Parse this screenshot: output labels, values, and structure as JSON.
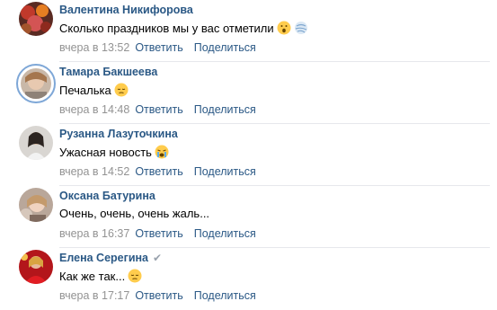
{
  "comments": [
    {
      "author": "Валентина Никифорова",
      "verified": false,
      "text": "Сколько праздников мы у вас отметили",
      "emojis": [
        "astonished-face",
        "wind-face"
      ],
      "date": "вчера в 13:52",
      "reply_label": "Ответить",
      "share_label": "Поделиться",
      "avatar_icon": "avatar-photo"
    },
    {
      "author": "Тамара Бакшеева",
      "verified": false,
      "text": "Печалька",
      "emojis": [
        "pensive-face"
      ],
      "date": "вчера в 14:48",
      "reply_label": "Ответить",
      "share_label": "Поделиться",
      "avatar_icon": "avatar-photo"
    },
    {
      "author": "Рузанна Лазуточкина",
      "verified": false,
      "text": "Ужасная новость",
      "emojis": [
        "crying-face"
      ],
      "date": "вчера в 14:52",
      "reply_label": "Ответить",
      "share_label": "Поделиться",
      "avatar_icon": "avatar-photo"
    },
    {
      "author": "Оксана Батурина",
      "verified": false,
      "text": "Очень, очень, очень жаль...",
      "emojis": [],
      "date": "вчера в 16:37",
      "reply_label": "Ответить",
      "share_label": "Поделиться",
      "avatar_icon": "avatar-photo"
    },
    {
      "author": "Елена Серегина",
      "verified": true,
      "verified_mark": "✔",
      "text": "Как же так...",
      "emojis": [
        "pensive-face"
      ],
      "date": "вчера в 17:17",
      "reply_label": "Ответить",
      "share_label": "Поделиться",
      "avatar_icon": "avatar-photo"
    }
  ],
  "colors": {
    "author": "#2a5885",
    "link": "#2a5885",
    "date": "#939393",
    "divider": "#e7e8ec",
    "ring": "#7ea7d7"
  }
}
